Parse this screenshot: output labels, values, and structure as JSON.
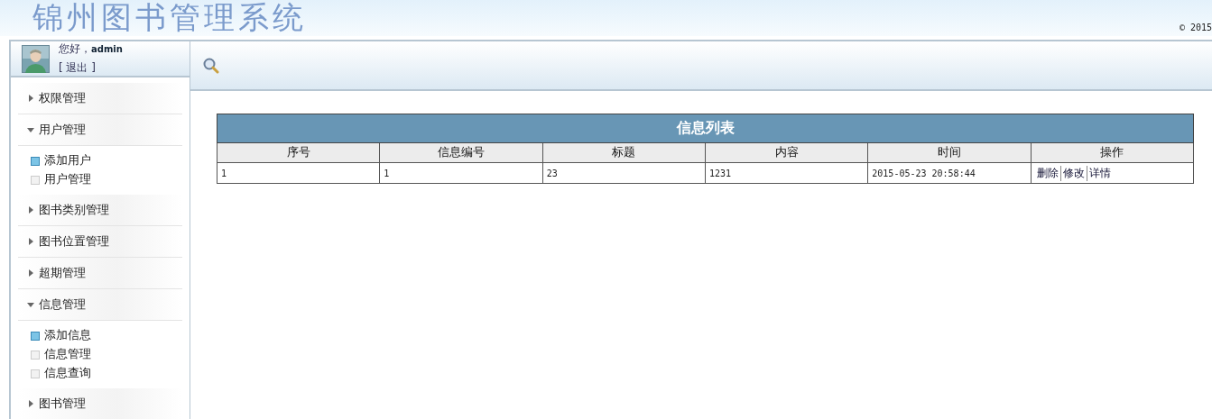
{
  "header": {
    "title": "锦州图书管理系统",
    "copyright": "© 2015"
  },
  "user": {
    "greeting": "您好，",
    "name": "admin",
    "logout": "[ 退出 ]"
  },
  "sidebar": {
    "groups": [
      {
        "label": "权限管理",
        "expanded": false
      },
      {
        "label": "用户管理",
        "expanded": true,
        "children": [
          {
            "label": "添加用户",
            "selected": true
          },
          {
            "label": "用户管理",
            "selected": false
          }
        ]
      },
      {
        "label": "图书类别管理",
        "expanded": false
      },
      {
        "label": "图书位置管理",
        "expanded": false
      },
      {
        "label": "超期管理",
        "expanded": false
      },
      {
        "label": "信息管理",
        "expanded": true,
        "children": [
          {
            "label": "添加信息",
            "selected": true
          },
          {
            "label": "信息管理",
            "selected": false
          },
          {
            "label": "信息查询",
            "selected": false
          }
        ]
      },
      {
        "label": "图书管理",
        "expanded": false
      }
    ]
  },
  "table": {
    "title": "信息列表",
    "columns": [
      "序号",
      "信息编号",
      "标题",
      "内容",
      "时间",
      "操作"
    ],
    "rows": [
      {
        "cells": [
          "1",
          "1",
          "23",
          "1231",
          "2015-05-23 20:58:44"
        ],
        "actions": [
          "删除",
          "修改",
          "详情"
        ]
      }
    ]
  }
}
